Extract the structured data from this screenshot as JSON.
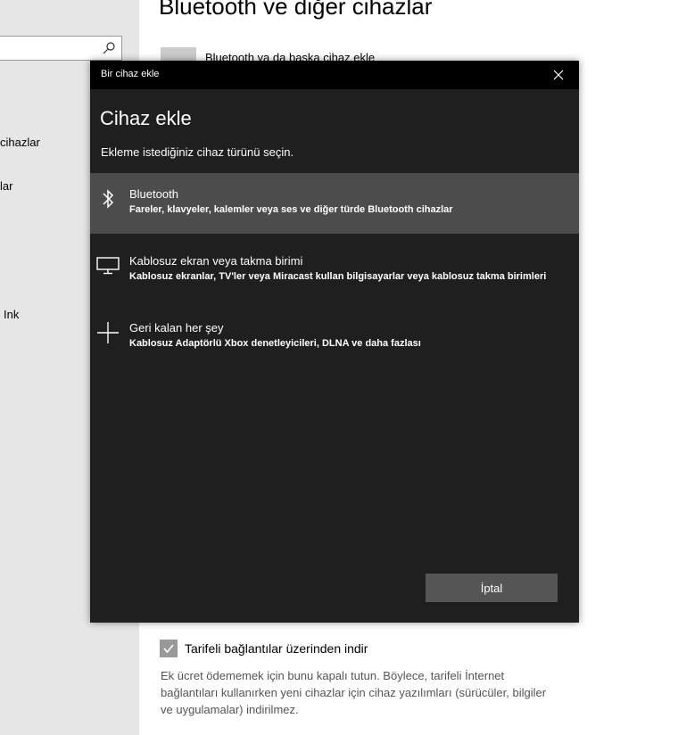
{
  "settings": {
    "page_title": "Bluetooth ve diğer cihazlar",
    "add_device_label": "Bluetooth ya da başka cihaz ekle",
    "nav_items": [
      "cihazlar",
      "lar",
      "Ink"
    ],
    "metered_label": "Tarifeli bağlantılar üzerinden indir",
    "metered_checked": true,
    "metered_description": "Ek ücret ödememek için bunu kapalı tutun. Böylece, tarifeli İnternet bağlantıları kullanırken yeni cihazlar için cihaz yazılımları (sürücüler, bilgiler ve uygulamalar) indirilmez."
  },
  "dialog": {
    "window_title": "Bir cihaz ekle",
    "heading": "Cihaz ekle",
    "subtitle": "Ekleme istediğiniz cihaz türünü seçin.",
    "options": [
      {
        "title": "Bluetooth",
        "description": "Fareler, klavyeler, kalemler veya ses ve diğer türde Bluetooth cihazlar",
        "icon": "bluetooth-icon",
        "selected": true
      },
      {
        "title": "Kablosuz ekran veya takma birimi",
        "description": "Kablosuz ekranlar, TV'ler veya Miracast kullan bilgisayarlar veya kablosuz takma birimleri",
        "icon": "monitor-icon",
        "selected": false
      },
      {
        "title": "Geri kalan her şey",
        "description": "Kablosuz Adaptörlü Xbox denetleyicileri, DLNA ve daha fazlası",
        "icon": "plus-icon",
        "selected": false
      }
    ],
    "cancel_label": "İptal"
  },
  "colors": {
    "dialog_bg": "#1f1f1f",
    "titlebar_bg": "#000000",
    "selected_bg": "#4c4c4c",
    "button_bg": "#555555"
  }
}
